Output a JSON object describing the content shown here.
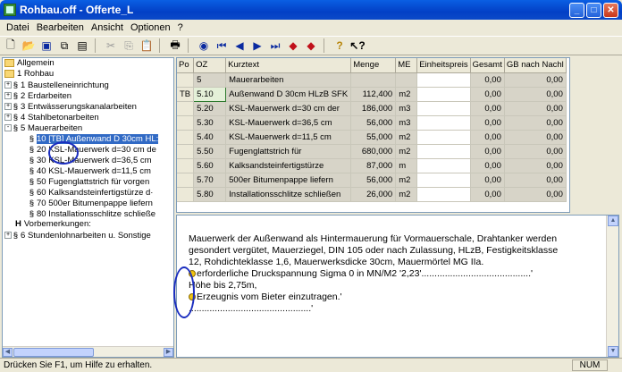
{
  "window": {
    "title": "Rohbau.off - Offerte_L"
  },
  "menu": [
    "Datei",
    "Bearbeiten",
    "Ansicht",
    "Optionen",
    "?"
  ],
  "tree": [
    {
      "label": "Allgemein",
      "kind": "folder",
      "level": 0
    },
    {
      "label": "1 Rohbau",
      "kind": "folder",
      "level": 0
    },
    {
      "label": "1 Baustelleneinrichtung",
      "kind": "para",
      "level": 0,
      "exp": "+"
    },
    {
      "label": "2 Erdarbeiten",
      "kind": "para",
      "level": 0,
      "exp": "+"
    },
    {
      "label": "3 Entwässerungskanalarbeiten",
      "kind": "para",
      "level": 0,
      "exp": "+"
    },
    {
      "label": "4 Stahlbetonarbeiten",
      "kind": "para",
      "level": 0,
      "exp": "+"
    },
    {
      "label": "5 Mauerarbeiten",
      "kind": "para",
      "level": 0,
      "exp": "-"
    },
    {
      "label": "10 [TB] Außenwand D 30cm HL:",
      "kind": "para",
      "level": 1,
      "selected": true
    },
    {
      "label": "20 KSL-Mauerwerk d=30 cm de",
      "kind": "para",
      "level": 1
    },
    {
      "label": "30 KSL-Mauerwerk d=36,5 cm",
      "kind": "para",
      "level": 1
    },
    {
      "label": "40 KSL-Mauerwerk d=11,5 cm",
      "kind": "para",
      "level": 1
    },
    {
      "label": "50 Fugenglattstrich für vorgen",
      "kind": "para",
      "level": 1
    },
    {
      "label": "60 Kalksandsteinfertigstürze d·",
      "kind": "para",
      "level": 1
    },
    {
      "label": "70 500er Bitumenpappe liefern",
      "kind": "para",
      "level": 1
    },
    {
      "label": "80 Installationsschlitze schließe",
      "kind": "para",
      "level": 1
    },
    {
      "label": "Vorbemerkungen:",
      "kind": "hh",
      "level": 0
    },
    {
      "label": "6 Stundenlohnarbeiten u. Sonstige",
      "kind": "para",
      "level": 0,
      "exp": "+"
    }
  ],
  "grid": {
    "headers": [
      "Po",
      "OZ",
      "Kurztext",
      "Menge",
      "ME",
      "Einheitspreis",
      "Gesamt",
      "GB nach Nachl"
    ],
    "rows": [
      {
        "po": "",
        "oz": "5",
        "kurztext": "Mauerarbeiten",
        "menge": "",
        "me": "",
        "ep": "",
        "gesamt": "0,00",
        "gb": "0,00"
      },
      {
        "po": "TB",
        "oz": "5.10",
        "kurztext": "Außenwand D 30cm HLzB SFK",
        "menge": "112,400",
        "me": "m2",
        "ep": "",
        "gesamt": "0,00",
        "gb": "0,00",
        "active": true
      },
      {
        "po": "",
        "oz": "5.20",
        "kurztext": "KSL-Mauerwerk d=30 cm der",
        "menge": "186,000",
        "me": "m3",
        "ep": "",
        "gesamt": "0,00",
        "gb": "0,00"
      },
      {
        "po": "",
        "oz": "5.30",
        "kurztext": "KSL-Mauerwerk d=36,5 cm",
        "menge": "56,000",
        "me": "m3",
        "ep": "",
        "gesamt": "0,00",
        "gb": "0,00"
      },
      {
        "po": "",
        "oz": "5.40",
        "kurztext": "KSL-Mauerwerk d=11,5 cm",
        "menge": "55,000",
        "me": "m2",
        "ep": "",
        "gesamt": "0,00",
        "gb": "0,00"
      },
      {
        "po": "",
        "oz": "5.50",
        "kurztext": "Fugenglattstrich für",
        "menge": "680,000",
        "me": "m2",
        "ep": "",
        "gesamt": "0,00",
        "gb": "0,00"
      },
      {
        "po": "",
        "oz": "5.60",
        "kurztext": "Kalksandsteinfertigstürze",
        "menge": "87,000",
        "me": "m",
        "ep": "",
        "gesamt": "0,00",
        "gb": "0,00"
      },
      {
        "po": "",
        "oz": "5.70",
        "kurztext": "500er Bitumenpappe liefern",
        "menge": "56,000",
        "me": "m2",
        "ep": "",
        "gesamt": "0,00",
        "gb": "0,00"
      },
      {
        "po": "",
        "oz": "5.80",
        "kurztext": "Installationsschlitze schließen",
        "menge": "26,000",
        "me": "m2",
        "ep": "",
        "gesamt": "0,00",
        "gb": "0,00"
      }
    ]
  },
  "longtext": {
    "line1": "Mauerwerk der Außenwand als Hintermauerung für Vormauerschale, Drahtanker werden",
    "line2": "gesondert vergütet, Mauerziegel, DIN 105 oder nach Zulassung, HLzB, Festigkeitsklasse",
    "line3": "12, Rohdichteklasse 1,6, Mauerwerksdicke 30cm, Mauermörtel MG IIa.",
    "line4": "erforderliche Druckspannung Sigma 0 in MN/M2 '2,23'..........................................'",
    "line5": "Höhe bis 2,75m,",
    "line6": "Erzeugnis vom Bieter einzutragen.'",
    "line7": "...............................................'"
  },
  "status": {
    "message": "Drücken Sie F1, um Hilfe zu erhalten.",
    "num": "NUM"
  }
}
